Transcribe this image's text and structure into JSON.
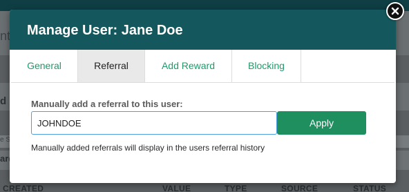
{
  "background": {
    "panel_text": "nt",
    "row1_text": "d R",
    "row2_text": "e S",
    "row3_text": "ard",
    "table_headers": [
      "CREATED",
      "VALUE",
      "TYPE",
      "SOURCE",
      "STATUS"
    ]
  },
  "modal": {
    "title": "Manage User: Jane Doe",
    "close_icon": "close-icon",
    "tabs": [
      {
        "label": "General",
        "active": false
      },
      {
        "label": "Referral",
        "active": true
      },
      {
        "label": "Add Reward",
        "active": false
      },
      {
        "label": "Blocking",
        "active": false
      }
    ],
    "referral": {
      "field_label": "Manually add a referral to this user:",
      "input_value": "JOHNDOE",
      "apply_label": "Apply",
      "helper_text": "Manually added referrals will display in the users referral history"
    }
  },
  "colors": {
    "header_bg": "#14585d",
    "accent_green": "#1f8f5f",
    "tab_text": "#1f9a6a",
    "input_focus_border": "#4c9ee0"
  }
}
